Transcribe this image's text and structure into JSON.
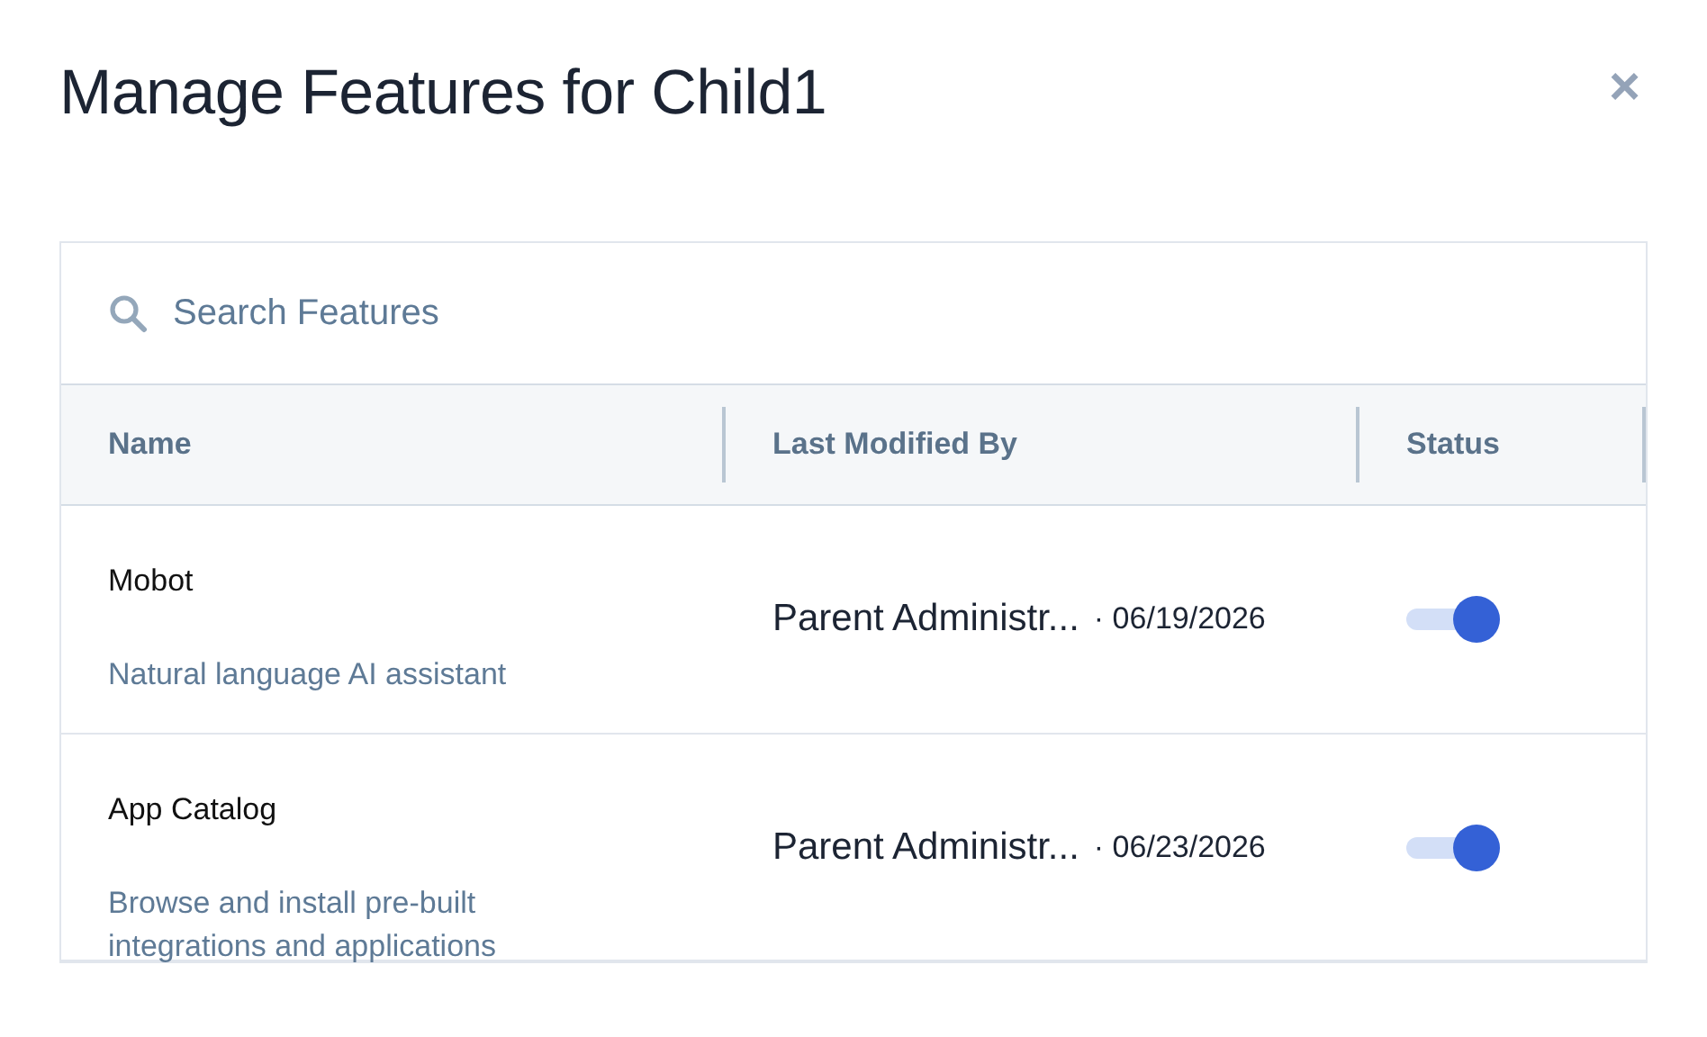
{
  "dialog": {
    "title": "Manage Features for Child1",
    "close": "×"
  },
  "search": {
    "placeholder": "Search Features"
  },
  "table": {
    "columns": [
      "Name",
      "Last Modified By",
      "Status"
    ],
    "rows": [
      {
        "name": "Mobot",
        "description": "Natural language AI assistant",
        "modified_by": "Parent Administr...",
        "date": "· 06/19/2026",
        "on": true
      },
      {
        "name": "App Catalog",
        "description": "Browse and install pre-built integrations and applications",
        "modified_by": "Parent Administr...",
        "date": "· 06/23/2026",
        "on": true
      }
    ]
  }
}
